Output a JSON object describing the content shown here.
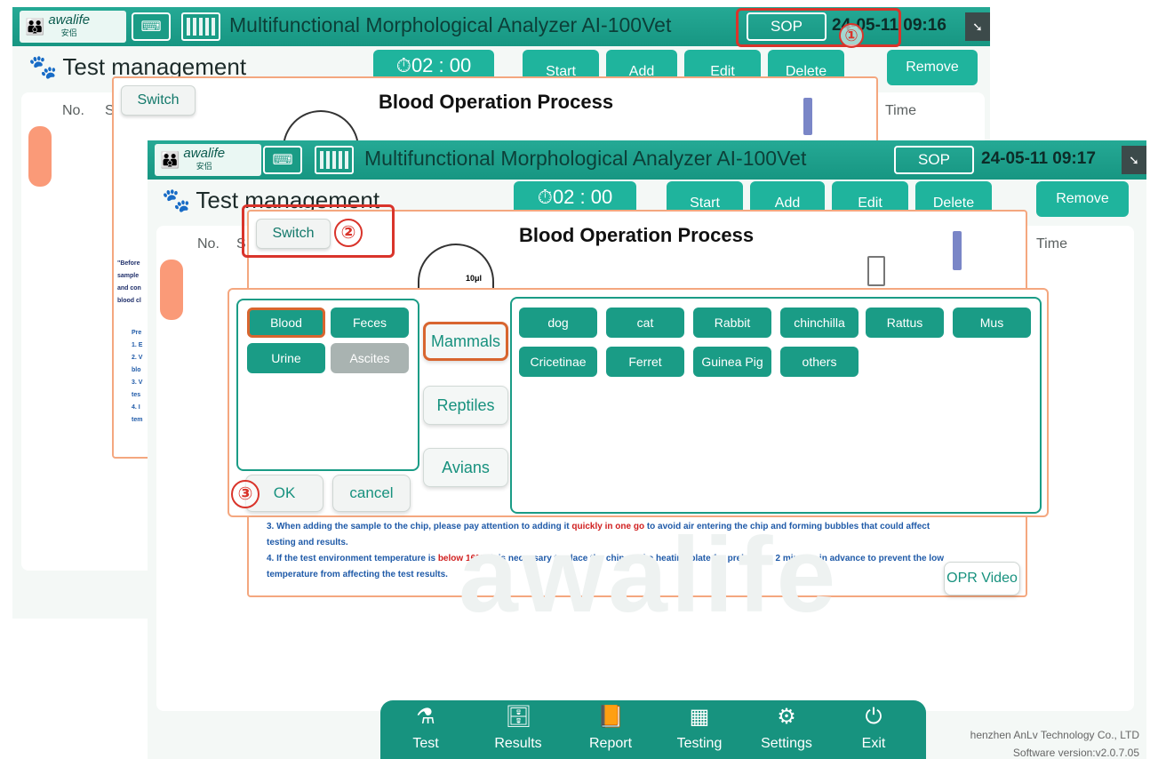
{
  "app": {
    "logo_text": "awalife",
    "logo_sub": "安侣",
    "title": "Multifunctional Morphological Analyzer AI-100Vet",
    "sop_label": "SOP",
    "time_back": "24-05-11 09:16",
    "time_front": "24-05-11 09:17"
  },
  "page": {
    "title": "Test management",
    "timer": "02 : 00",
    "buttons": {
      "start": "Start",
      "add": "Add",
      "edit": "Edit",
      "delete": "Delete",
      "remove": "Remove"
    },
    "columns": {
      "no": "No.",
      "s": "S",
      "time": "Time"
    }
  },
  "process": {
    "switch_label": "Switch",
    "title": "Blood Operation Process",
    "volume_label": "10μl",
    "side_text": [
      "\"Before",
      "sample",
      "and con",
      "blood cl"
    ],
    "side_steps": [
      "Pre",
      "1. E",
      "2. V",
      "blo",
      "3. V",
      "tes",
      "4. I",
      "tem"
    ]
  },
  "selector": {
    "sample_types": [
      {
        "label": "Blood",
        "selected": true,
        "enabled": true
      },
      {
        "label": "Feces",
        "selected": false,
        "enabled": true
      },
      {
        "label": "Urine",
        "selected": false,
        "enabled": true
      },
      {
        "label": "Ascites",
        "selected": false,
        "enabled": false
      }
    ],
    "categories": [
      {
        "label": "Mammals",
        "active": true
      },
      {
        "label": "Reptiles",
        "active": false
      },
      {
        "label": "Avians",
        "active": false
      }
    ],
    "species": [
      "dog",
      "cat",
      "Rabbit",
      "chinchilla",
      "Rattus",
      "Mus",
      "Cricetinae",
      "Ferret",
      "Guinea Pig",
      "others"
    ],
    "ok_label": "OK",
    "cancel_label": "cancel"
  },
  "notes": {
    "note3_a": "3. When adding the sample to the chip, please pay attention to adding it ",
    "note3_red": "quickly in one go",
    "note3_b": " to avoid air entering the chip and forming bubbles that could affect",
    "note3_c": "testing and results.",
    "note4_a": "4. If the test environment temperature is ",
    "note4_red": "below 16°C",
    "note4_b": ", it is necessary to place the chip on the heating plate for preheating 2 minutes in advance to prevent the low",
    "note4_c": "temperature from affecting the test results.",
    "opr_video": "OPR Video"
  },
  "watermark": "awalife",
  "callouts": [
    "①",
    "②",
    "③"
  ],
  "nav": [
    "Test",
    "Results",
    "Report",
    "Testing",
    "Settings",
    "Exit"
  ],
  "footer": {
    "company": "henzhen AnLv Technology Co., LTD",
    "version": "Software version:v2.0.7.05"
  },
  "colors": {
    "primary": "#1a9c86",
    "accent_orange": "#f4a77f",
    "annotation_red": "#d9342b",
    "nav_green": "#17937f"
  }
}
